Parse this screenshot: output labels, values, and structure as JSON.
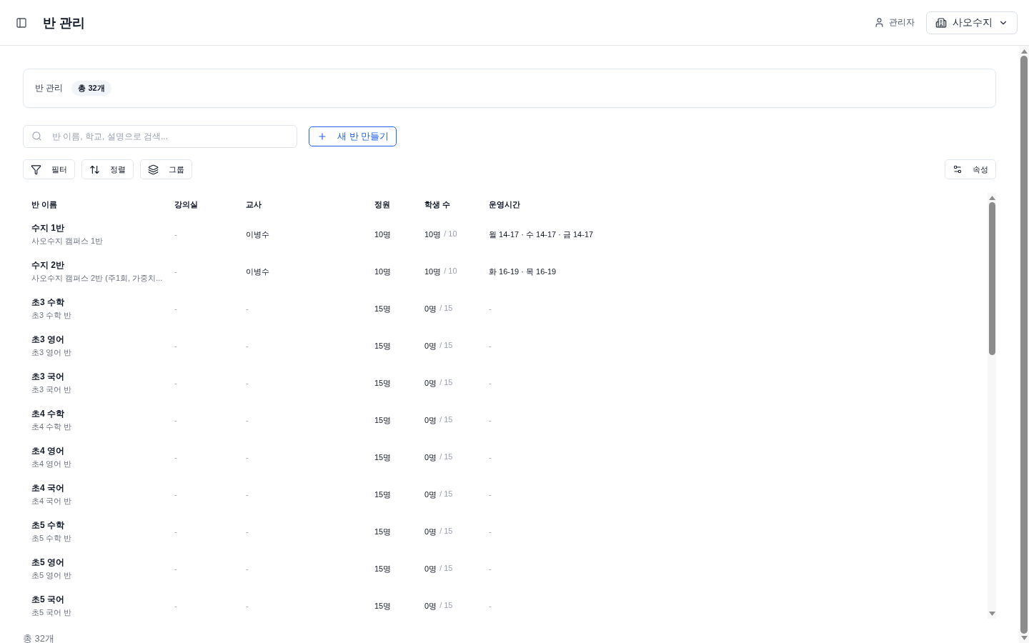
{
  "header": {
    "title": "반 관리",
    "user": "관리자",
    "campus": "사오수지"
  },
  "summary": {
    "title": "반 관리",
    "badge": "총 32개"
  },
  "search": {
    "placeholder": "반 이름, 학교, 설명으로 검색..."
  },
  "new_button": {
    "label": "새 반 만들기"
  },
  "toolbar": [
    {
      "label": "필터",
      "kind": "filter"
    },
    {
      "label": "정렬",
      "kind": "sort"
    },
    {
      "label": "그룹",
      "kind": "group"
    }
  ],
  "properties_button": {
    "label": "속성"
  },
  "table": {
    "columns": [
      "반 이름",
      "강의실",
      "교사",
      "정원",
      "학생 수",
      "운영시간"
    ],
    "rows": [
      {
        "name": "수지 1반",
        "description": "사오수지 캠퍼스 1반",
        "room": "-",
        "teacher": "이병수",
        "capacity": "10명",
        "students": "10명",
        "students_total": "/ 10",
        "schedule": "월 14-17 · 수 14-17 · 금 14-17"
      },
      {
        "name": "수지 2반",
        "description": "사오수지 캠퍼스 2반 (주1회, 가중치...",
        "room": "-",
        "teacher": "이병수",
        "capacity": "10명",
        "students": "10명",
        "students_total": "/ 10",
        "schedule": "화 16-19 · 목 16-19"
      },
      {
        "name": "초3 수학",
        "description": "초3 수학 반",
        "room": "-",
        "teacher": "-",
        "capacity": "15명",
        "students": "0명",
        "students_total": "/ 15",
        "schedule": "-"
      },
      {
        "name": "초3 영어",
        "description": "초3 영어 반",
        "room": "-",
        "teacher": "-",
        "capacity": "15명",
        "students": "0명",
        "students_total": "/ 15",
        "schedule": "-"
      },
      {
        "name": "초3 국어",
        "description": "초3 국어 반",
        "room": "-",
        "teacher": "-",
        "capacity": "15명",
        "students": "0명",
        "students_total": "/ 15",
        "schedule": "-"
      },
      {
        "name": "초4 수학",
        "description": "초4 수학 반",
        "room": "-",
        "teacher": "-",
        "capacity": "15명",
        "students": "0명",
        "students_total": "/ 15",
        "schedule": "-"
      },
      {
        "name": "초4 영어",
        "description": "초4 영어 반",
        "room": "-",
        "teacher": "-",
        "capacity": "15명",
        "students": "0명",
        "students_total": "/ 15",
        "schedule": "-"
      },
      {
        "name": "초4 국어",
        "description": "초4 국어 반",
        "room": "-",
        "teacher": "-",
        "capacity": "15명",
        "students": "0명",
        "students_total": "/ 15",
        "schedule": "-"
      },
      {
        "name": "초5 수학",
        "description": "초5 수학 반",
        "room": "-",
        "teacher": "-",
        "capacity": "15명",
        "students": "0명",
        "students_total": "/ 15",
        "schedule": "-"
      },
      {
        "name": "초5 영어",
        "description": "초5 영어 반",
        "room": "-",
        "teacher": "-",
        "capacity": "15명",
        "students": "0명",
        "students_total": "/ 15",
        "schedule": "-"
      },
      {
        "name": "초5 국어",
        "description": "초5 국어 반",
        "room": "-",
        "teacher": "-",
        "capacity": "15명",
        "students": "0명",
        "students_total": "/ 15",
        "schedule": "-"
      }
    ]
  },
  "footer": {
    "total": "총 32개"
  }
}
